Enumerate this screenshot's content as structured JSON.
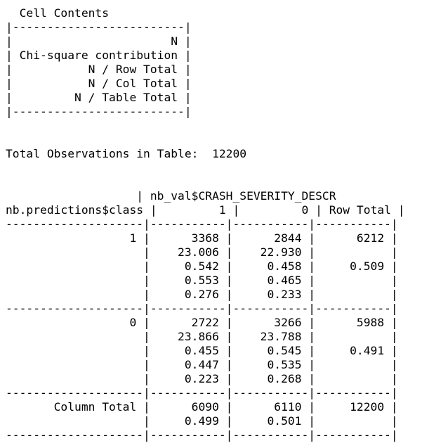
{
  "console": {
    "lines": [
      "  Cell Contents",
      "|-------------------------|",
      "|                       N |",
      "| Chi-square contribution |",
      "|           N / Row Total |",
      "|           N / Col Total |",
      "|         N / Table Total |",
      "|-------------------------|",
      "",
      "",
      "Total Observations in Table:  12200",
      "",
      "",
      "                   | nb_val$CRASH_SEVERITY_DESCR",
      "nb.predictions$class |         1 |         0 | Row Total |",
      "--------------------|-----------|-----------|-----------|",
      "                  1 |      3368 |      2844 |      6212 |",
      "                    |    23.006 |    22.930 |           |",
      "                    |     0.542 |     0.458 |     0.509 |",
      "                    |     0.553 |     0.465 |           |",
      "                    |     0.276 |     0.233 |           |",
      "--------------------|-----------|-----------|-----------|",
      "                  0 |      2722 |      3266 |      5988 |",
      "                    |    23.866 |    23.788 |           |",
      "                    |     0.455 |     0.545 |     0.491 |",
      "                    |     0.447 |     0.535 |           |",
      "                    |     0.223 |     0.268 |           |",
      "--------------------|-----------|-----------|-----------|",
      "       Column Total |      6090 |      6110 |     12200 |",
      "                    |     0.499 |     0.501 |           |",
      "--------------------|-----------|-----------|-----------|"
    ]
  }
}
